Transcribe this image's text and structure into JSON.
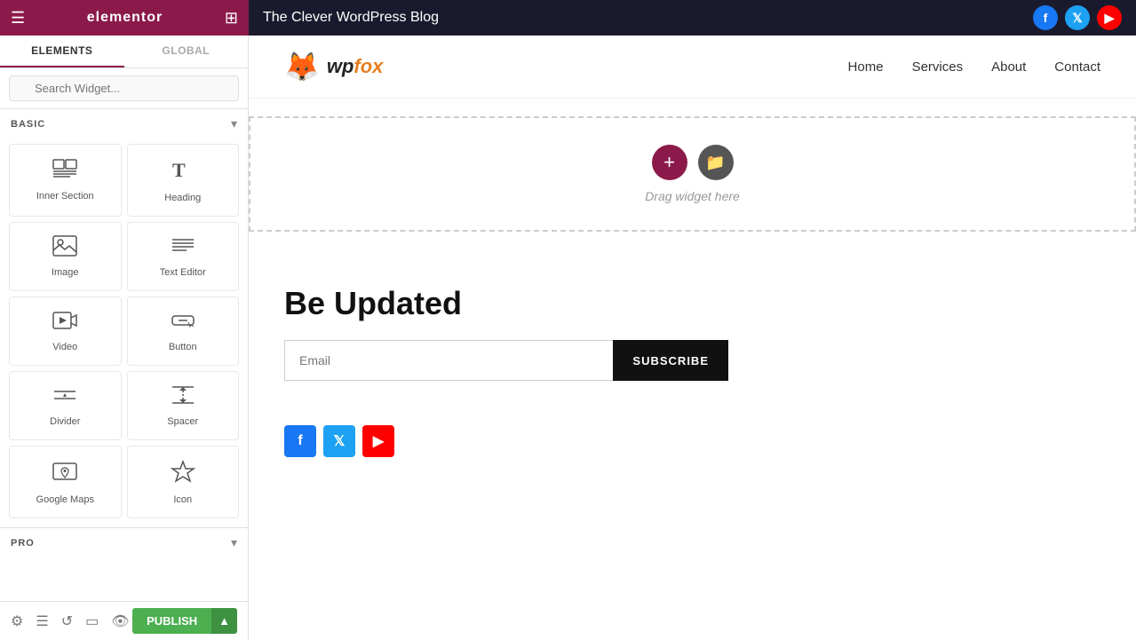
{
  "topbar": {
    "logo": "elementor",
    "page_title": "The Clever WordPress Blog",
    "socials": [
      "Facebook",
      "Twitter",
      "YouTube"
    ]
  },
  "sidebar": {
    "tabs": [
      "ELEMENTS",
      "GLOBAL"
    ],
    "active_tab": "ELEMENTS",
    "search_placeholder": "Search Widget...",
    "basic_section_label": "BASIC",
    "pro_section_label": "PRO",
    "widgets": [
      {
        "id": "inner-section",
        "label": "Inner Section",
        "icon": "inner-section-icon"
      },
      {
        "id": "heading",
        "label": "Heading",
        "icon": "heading-icon"
      },
      {
        "id": "image",
        "label": "Image",
        "icon": "image-icon"
      },
      {
        "id": "text-editor",
        "label": "Text Editor",
        "icon": "text-editor-icon"
      },
      {
        "id": "video",
        "label": "Video",
        "icon": "video-icon"
      },
      {
        "id": "button",
        "label": "Button",
        "icon": "button-icon"
      },
      {
        "id": "divider",
        "label": "Divider",
        "icon": "divider-icon"
      },
      {
        "id": "spacer",
        "label": "Spacer",
        "icon": "spacer-icon"
      },
      {
        "id": "google-maps",
        "label": "Google Maps",
        "icon": "google-maps-icon"
      },
      {
        "id": "icon",
        "label": "Icon",
        "icon": "icon-icon"
      }
    ],
    "bottom_icons": [
      "settings",
      "layers",
      "history",
      "responsive",
      "preview"
    ],
    "publish_label": "PUBLISH"
  },
  "canvas": {
    "site_logo_text": "wpfox",
    "nav_items": [
      "Home",
      "Services",
      "About",
      "Contact"
    ],
    "drop_zone_text": "Drag widget here",
    "be_updated_title": "Be Updated",
    "email_placeholder": "Email",
    "subscribe_label": "SUBSCRIBE"
  }
}
